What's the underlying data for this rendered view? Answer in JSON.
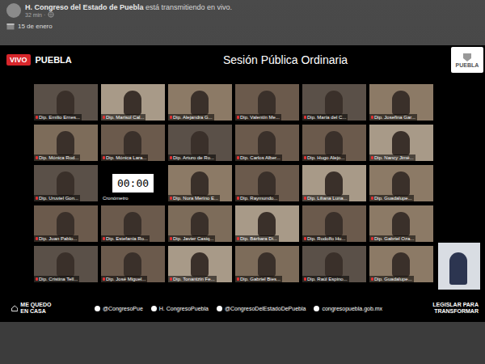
{
  "post": {
    "page": "H. Congreso del Estado de Puebla",
    "status": "está transmitiendo en vivo.",
    "time": "32 min ·",
    "date": "15 de enero"
  },
  "stream": {
    "live_badge": "VIVO",
    "logo": "PUEBLA",
    "title": "Sesión Pública Ordinaria",
    "right_logo": "PUEBLA"
  },
  "participants": [
    {
      "name": "Dip. Emilio Ernes...",
      "kind": "video"
    },
    {
      "name": "Dip. Marisol Cal...",
      "kind": "video"
    },
    {
      "name": "Dip. Alejandra G...",
      "kind": "video"
    },
    {
      "name": "Dip. Valentín Me...",
      "kind": "video"
    },
    {
      "name": "Dip. María del C...",
      "kind": "video"
    },
    {
      "name": "Dip. Josefina Gar...",
      "kind": "video"
    },
    {
      "name": "Dip. Mónica Rod...",
      "kind": "video"
    },
    {
      "name": "Dip. Mónica Lara...",
      "kind": "video"
    },
    {
      "name": "Dip. Arturo de Ro...",
      "kind": "video"
    },
    {
      "name": "Dip. Carlos Alber...",
      "kind": "video"
    },
    {
      "name": "Dip. Hugo Alejo...",
      "kind": "video"
    },
    {
      "name": "Dip. Nancy Jimé...",
      "kind": "video"
    },
    {
      "name": "Dip. Uruviel Gon...",
      "kind": "video"
    },
    {
      "name": "Cronómetro",
      "kind": "timer",
      "timer": "00:00"
    },
    {
      "name": "Dip. Nora Merino E...",
      "kind": "video"
    },
    {
      "name": "Dip. Raymundo...",
      "kind": "video"
    },
    {
      "name": "Dip. Liliana Luna...",
      "kind": "video"
    },
    {
      "name": "Dip. Guadalupe...",
      "kind": "video"
    },
    {
      "name": "Dip. Juan Pablo...",
      "kind": "video"
    },
    {
      "name": "Dip. Estefanía Ro...",
      "kind": "video"
    },
    {
      "name": "Dip. Javier Casiq...",
      "kind": "video"
    },
    {
      "name": "Dip. Bárbara Di...",
      "kind": "video"
    },
    {
      "name": "Dip. Rodolfo Hu...",
      "kind": "video"
    },
    {
      "name": "Dip. Gabriel Oza...",
      "kind": "video"
    },
    {
      "name": "Dip. Cristina Tell...",
      "kind": "video"
    },
    {
      "name": "Dip. José Miguel...",
      "kind": "video"
    },
    {
      "name": "Dip. Tonantzin Fe...",
      "kind": "video"
    },
    {
      "name": "Dip. Gabriel Bies...",
      "kind": "video"
    },
    {
      "name": "Dip. Raúl Espino...",
      "kind": "video"
    },
    {
      "name": "Dip. Guadalupe...",
      "kind": "video"
    }
  ],
  "footer": {
    "campaign": "ME QUEDO EN CASA",
    "links": [
      {
        "label": "@CongresoPue",
        "kind": "twitter"
      },
      {
        "label": "H. CongresoPuebla",
        "kind": "facebook"
      },
      {
        "label": "@CongresoDelEstadoDePuebla",
        "kind": "instagram"
      },
      {
        "label": "congresopuebla.gob.mx",
        "kind": "web"
      }
    ],
    "slogan": "LEGISLAR PARA TRANSFORMAR"
  }
}
